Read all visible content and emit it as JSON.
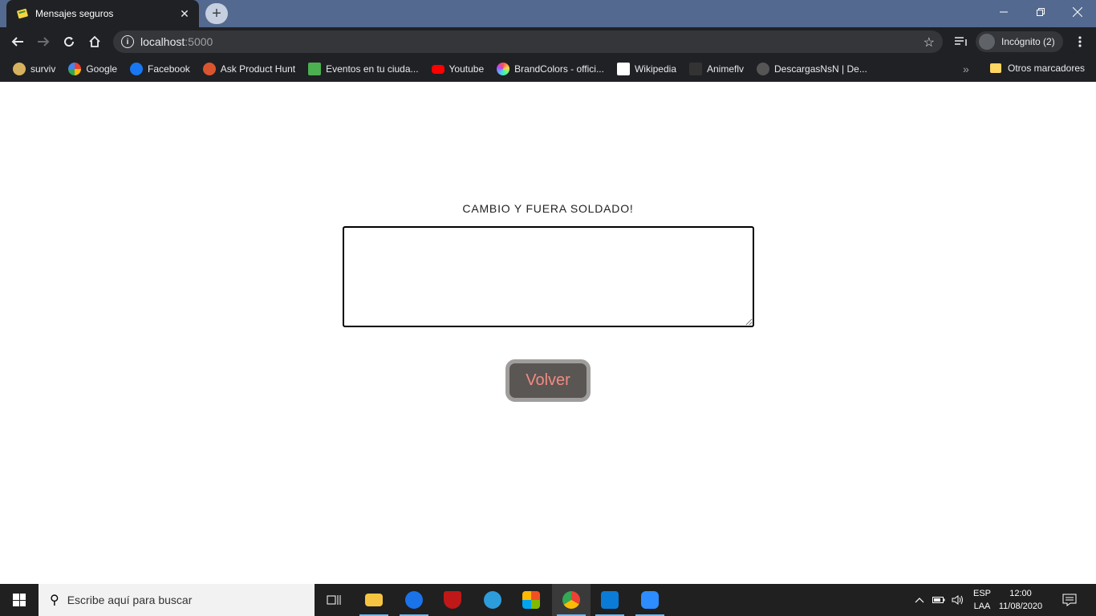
{
  "browser": {
    "tab_title": "Mensajes seguros",
    "tab_close": "✕",
    "new_tab": "+",
    "url_host": "localhost",
    "url_port": ":5000",
    "incognito_label": "Incógnito (2)",
    "bookmarks": [
      {
        "label": "surviv",
        "icon": "surviv-icon",
        "color": "#d6b25e"
      },
      {
        "label": "Google",
        "icon": "google-icon",
        "color": "#ffffff"
      },
      {
        "label": "Facebook",
        "icon": "facebook-icon",
        "color": "#1877f2"
      },
      {
        "label": "Ask Product Hunt",
        "icon": "product-hunt-icon",
        "color": "#da552f"
      },
      {
        "label": "Eventos en tu ciuda...",
        "icon": "eventos-icon",
        "color": "#4caf50"
      },
      {
        "label": "Youtube",
        "icon": "youtube-icon",
        "color": "#ff0000"
      },
      {
        "label": "BrandColors - offici...",
        "icon": "brandcolors-icon",
        "color": "#b44cff"
      },
      {
        "label": "Wikipedia",
        "icon": "wikipedia-icon",
        "color": "#ffffff"
      },
      {
        "label": "Animeflv",
        "icon": "animeflv-icon",
        "color": "#333333"
      },
      {
        "label": "DescargasNsN | De...",
        "icon": "descargas-icon",
        "color": "#777777"
      }
    ],
    "bookmarks_more": "»",
    "other_bookmarks": "Otros marcadores"
  },
  "page": {
    "heading": "CAMBIO Y FUERA SOLDADO!",
    "message_value": "",
    "back_button": "Volver"
  },
  "taskbar": {
    "search_placeholder": "Escribe aquí para buscar",
    "lang_top": "ESP",
    "lang_bottom": "LAA",
    "time": "12:00",
    "date": "11/08/2020"
  }
}
